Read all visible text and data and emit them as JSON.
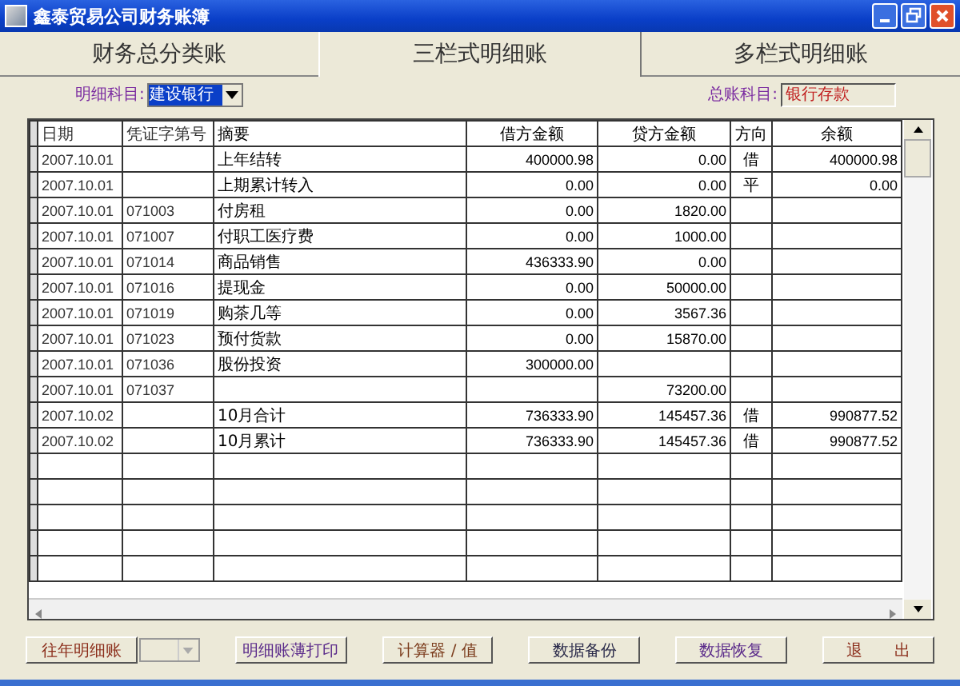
{
  "window": {
    "title": "鑫泰贸易公司财务账簿"
  },
  "tabs": [
    {
      "label": "财务总分类账",
      "selected": false
    },
    {
      "label": "三栏式明细账",
      "selected": true
    },
    {
      "label": "多栏式明细账",
      "selected": false
    }
  ],
  "detail_subject": {
    "label": "明细科目:",
    "value": "建设银行"
  },
  "general_subject": {
    "label": "总账科目:",
    "value": "银行存款"
  },
  "table": {
    "columns": [
      "日期",
      "凭证字第号",
      "摘要",
      "借方金额",
      "贷方金额",
      "方向",
      "余额"
    ],
    "rows": [
      [
        "2007.10.01",
        "",
        "上年结转",
        "400000.98",
        "0.00",
        "借",
        "400000.98"
      ],
      [
        "2007.10.01",
        "",
        "上期累计转入",
        "0.00",
        "0.00",
        "平",
        "0.00"
      ],
      [
        "2007.10.01",
        "071003",
        "付房租",
        "0.00",
        "1820.00",
        "",
        ""
      ],
      [
        "2007.10.01",
        "071007",
        "付职工医疗费",
        "0.00",
        "1000.00",
        "",
        ""
      ],
      [
        "2007.10.01",
        "071014",
        "商品销售",
        "436333.90",
        "0.00",
        "",
        ""
      ],
      [
        "2007.10.01",
        "071016",
        "提现金",
        "0.00",
        "50000.00",
        "",
        ""
      ],
      [
        "2007.10.01",
        "071019",
        "购茶几等",
        "0.00",
        "3567.36",
        "",
        ""
      ],
      [
        "2007.10.01",
        "071023",
        "预付货款",
        "0.00",
        "15870.00",
        "",
        ""
      ],
      [
        "2007.10.01",
        "071036",
        "股份投资",
        "300000.00",
        "",
        "",
        ""
      ],
      [
        "2007.10.01",
        "071037",
        "",
        "",
        "73200.00",
        "",
        ""
      ],
      [
        "2007.10.02",
        "",
        "10月合计",
        "736333.90",
        "145457.36",
        "借",
        "990877.52"
      ],
      [
        "2007.10.02",
        "",
        "10月累计",
        "736333.90",
        "145457.36",
        "借",
        "990877.52"
      ]
    ]
  },
  "buttons": [
    {
      "kind": "button",
      "label": "往年明细账",
      "color": "#8b2d1a"
    },
    {
      "kind": "dropdown",
      "disabled": true
    },
    {
      "kind": "button",
      "label": "明细账薄打印",
      "color": "#5a2a8a"
    },
    {
      "kind": "button",
      "label": "计算器 / 值",
      "color": "#7a3a1a"
    },
    {
      "kind": "button",
      "label": "数据备份",
      "color": "#2a2a4a"
    },
    {
      "kind": "button",
      "label": "数据恢复",
      "color": "#5a2a8a"
    },
    {
      "kind": "button",
      "label": "退　　出",
      "color": "#8b2d1a"
    }
  ]
}
